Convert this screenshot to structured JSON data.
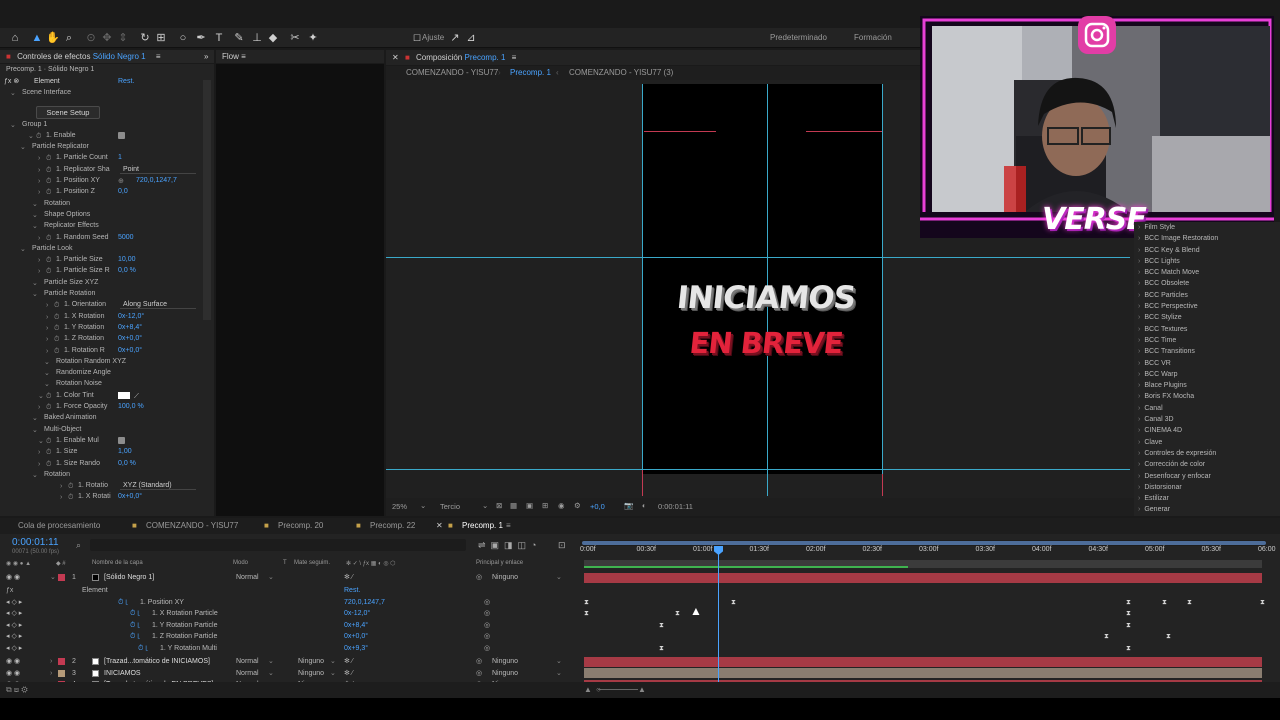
{
  "toolbar": {
    "ajuste_label": "Ajuste",
    "workspace1": "Predeterminado",
    "workspace2": "Formación"
  },
  "effects_panel": {
    "tab_label": "Controles de efectos",
    "tab_layer": "Sólido Negro 1",
    "path": "Precomp. 1 · Sólido Negro 1",
    "effect_name": "Element",
    "reset": "Rest.",
    "rows": [
      {
        "label": "Scene Interface"
      },
      {
        "label": "Group 1"
      },
      {
        "label": "1. Enable"
      },
      {
        "label": "Particle Replicator"
      },
      {
        "label": "1. Particle Count",
        "value": "1"
      },
      {
        "label": "1. Replicator Sha",
        "dropdown": "Point"
      },
      {
        "label": "1. Position XY",
        "value": "720,0,1247,7"
      },
      {
        "label": "1. Position Z",
        "value": "0,0"
      },
      {
        "label": "Rotation"
      },
      {
        "label": "Shape Options"
      },
      {
        "label": "Replicator Effects"
      },
      {
        "label": "1. Random Seed",
        "value": "5000"
      },
      {
        "label": "Particle Look"
      },
      {
        "label": "1. Particle Size",
        "value": "10,00"
      },
      {
        "label": "1. Particle Size R",
        "value": "0,0 %"
      },
      {
        "label": "Particle Size XYZ"
      },
      {
        "label": "Particle Rotation"
      },
      {
        "label": "1. Orientation",
        "dropdown": "Along Surface"
      },
      {
        "label": "1. X Rotation",
        "value": "0x-12,0°"
      },
      {
        "label": "1. Y Rotation",
        "value": "0x+8,4°"
      },
      {
        "label": "1. Z Rotation",
        "value": "0x+0,0°"
      },
      {
        "label": "1. Rotation R",
        "value": "0x+0,0°"
      },
      {
        "label": "Rotation Random XYZ"
      },
      {
        "label": "Randomize Angle"
      },
      {
        "label": "Rotation Noise"
      },
      {
        "label": "1. Color Tint"
      },
      {
        "label": "1. Force Opacity",
        "value": "100,0 %"
      },
      {
        "label": "Baked Animation"
      },
      {
        "label": "Multi-Object"
      },
      {
        "label": "1. Enable Mul"
      },
      {
        "label": "1. Size",
        "value": "1,00"
      },
      {
        "label": "1. Size Rando",
        "value": "0,0 %"
      },
      {
        "label": "Rotation"
      },
      {
        "label": "1. Rotatio",
        "dropdown": "XYZ (Standard)"
      },
      {
        "label": "1. X Rotati",
        "value": "0x+0,0°"
      }
    ],
    "scene_setup_label": "Scene Setup"
  },
  "flow_panel": {
    "title": "Flow"
  },
  "comp_panel": {
    "title": "Composición",
    "title_name": "Precomp. 1",
    "tabs": [
      "COMENZANDO - YISU77",
      "Precomp. 1",
      "COMENZANDO - YISU77 (3)"
    ],
    "headline_line1": "INICIAMOS",
    "headline_line2": "EN BREVE",
    "zoom": "25%",
    "resolution": "Tercio",
    "exposure": "+0,0",
    "timecode": "0:00:01:11"
  },
  "effects_list": [
    "Film Style",
    "BCC Image Restoration",
    "BCC Key & Blend",
    "BCC Lights",
    "BCC Match Move",
    "BCC Obsolete",
    "BCC Particles",
    "BCC Perspective",
    "BCC Stylize",
    "BCC Textures",
    "BCC Time",
    "BCC Transitions",
    "BCC VR",
    "BCC Warp",
    "Blace Plugins",
    "Boris FX Mocha",
    "Canal",
    "Canal 3D",
    "CINEMA 4D",
    "Clave",
    "Controles de expresión",
    "Corrección de color",
    "Desenfocar y enfocar",
    "Distorsionar",
    "Estilizar",
    "Generar"
  ],
  "webcam": {
    "overlay_text": "VERSE"
  },
  "timeline": {
    "tabs": [
      "Cola de procesamiento",
      "COMENZANDO - YISU77",
      "Precomp. 20",
      "Precomp. 22",
      "Precomp. 1"
    ],
    "current_time": "0:00:01:11",
    "current_frames": "00071 (50.00 fps)",
    "columns": {
      "name": "Nombre de la capa",
      "mode": "Modo",
      "t": "T",
      "matte": "Mate seguim.",
      "parent": "Principal y enlace"
    },
    "ruler": [
      "0:00f",
      "00:30f",
      "01:00f",
      "01:30f",
      "02:00f",
      "02:30f",
      "03:00f",
      "03:30f",
      "04:00f",
      "04:30f",
      "05:00f",
      "05:30f",
      "06:00"
    ],
    "layers": [
      {
        "num": "1",
        "name": "[Sólido Negro 1]",
        "mode": "Normal",
        "matte": "",
        "parent": "Ninguno"
      },
      {
        "num": "2",
        "name": "[Trazad...tomático de INICIAMOS]",
        "mode": "Normal",
        "matte": "Ninguno",
        "parent": "Ninguno"
      },
      {
        "num": "3",
        "name": "INICIAMOS",
        "mode": "Normal",
        "matte": "Ninguno",
        "parent": "Ninguno"
      },
      {
        "num": "4",
        "name": "[Trazad...tomático de EN BREVES]",
        "mode": "Normal",
        "matte": "Ninguno",
        "parent": "Ninguno"
      }
    ],
    "sub_rows": [
      {
        "label": "Element",
        "value": "Rest."
      },
      {
        "label": "1. Position XY",
        "value": "720,0,1247,7"
      },
      {
        "label": "1. X Rotation Particle",
        "value": "0x-12,0°"
      },
      {
        "label": "1. Y Rotation Particle",
        "value": "0x+8,4°"
      },
      {
        "label": "1. Z Rotation Particle",
        "value": "0x+0,0°"
      },
      {
        "label": "1. Y Rotation Multi",
        "value": "0x+9,3°"
      }
    ]
  }
}
